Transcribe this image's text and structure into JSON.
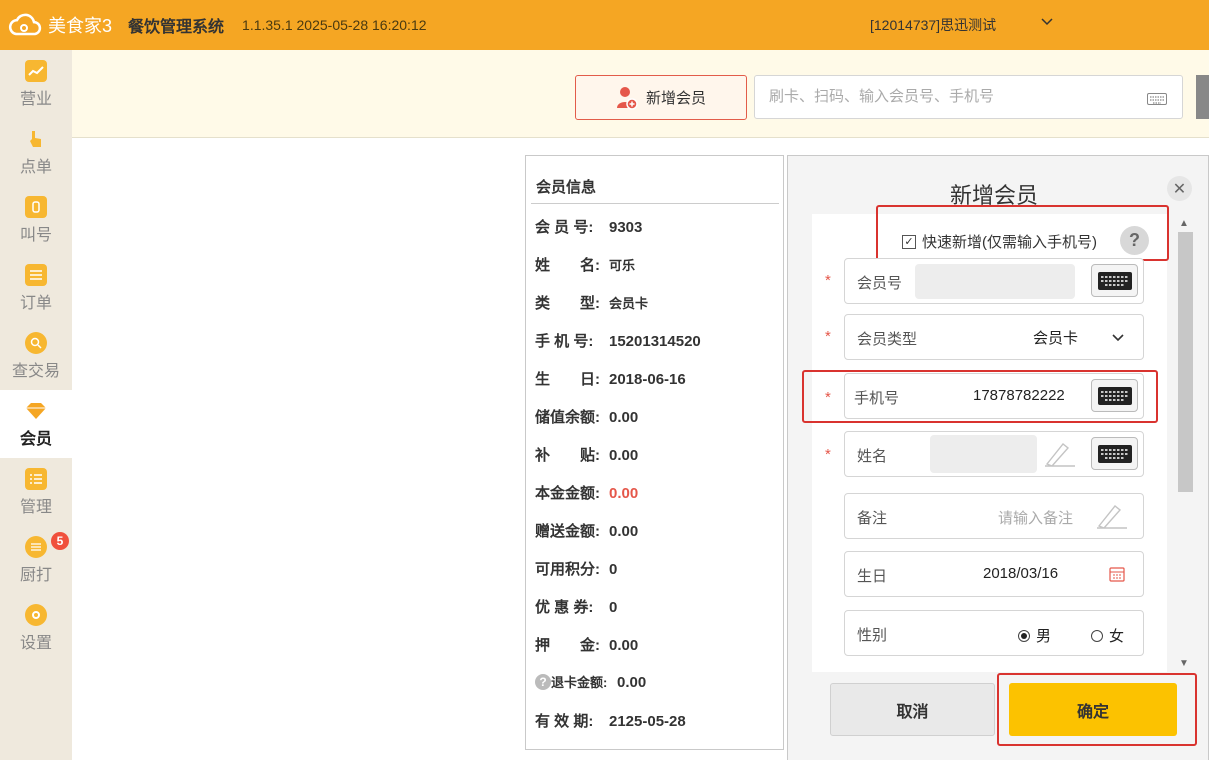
{
  "app": {
    "logo_text": "美食家3",
    "title": "餐饮管理系统",
    "version": "1.1.35.1 2025-05-28 16:20:12",
    "store": "[12014737]思迅测试"
  },
  "sidebar": {
    "items": [
      {
        "label": "营业",
        "icon": "chart-icon"
      },
      {
        "label": "点单",
        "icon": "hand-icon"
      },
      {
        "label": "叫号",
        "icon": "ticket-icon"
      },
      {
        "label": "订单",
        "icon": "list-icon"
      },
      {
        "label": "查交易",
        "icon": "search-icon"
      },
      {
        "label": "会员",
        "icon": "diamond-icon",
        "active": true
      },
      {
        "label": "管理",
        "icon": "checklist-icon"
      },
      {
        "label": "厨打",
        "icon": "printer-icon",
        "badge": "5"
      },
      {
        "label": "设置",
        "icon": "gear-icon"
      }
    ]
  },
  "header": {
    "add_member_label": "新增会员",
    "search_placeholder": "刷卡、扫码、输入会员号、手机号"
  },
  "member_info": {
    "title": "会员信息",
    "rows": [
      {
        "key": "会 员 号:",
        "value": "9303"
      },
      {
        "key": "姓　　名:",
        "value": "可乐"
      },
      {
        "key": "类　　型:",
        "value": "会员卡"
      },
      {
        "key": "手 机 号:",
        "value": "15201314520"
      },
      {
        "key": "生　　日:",
        "value": "2018-06-16"
      },
      {
        "key": "储值余额:",
        "value": "0.00"
      },
      {
        "key": "补　　贴:",
        "value": "0.00"
      },
      {
        "key": "本金金额:",
        "value": "0.00"
      },
      {
        "key": "赠送金额:",
        "value": "0.00"
      },
      {
        "key": "可用积分:",
        "value": "0"
      },
      {
        "key": "优 惠 券:",
        "value": "0"
      },
      {
        "key": "押　　金:",
        "value": "0.00"
      },
      {
        "key": "退卡金额:",
        "value": "0.00"
      },
      {
        "key": "有 效 期:",
        "value": "2125-05-28"
      }
    ]
  },
  "form": {
    "title": "新增会员",
    "quick_add_label": "快速新增(仅需输入手机号)",
    "quick_add_checked": true,
    "help": "?",
    "fields": {
      "member_no": {
        "label": "会员号",
        "value": ""
      },
      "member_type": {
        "label": "会员类型",
        "value": "会员卡"
      },
      "phone": {
        "label": "手机号",
        "value": "17878782222"
      },
      "name": {
        "label": "姓名",
        "value": ""
      },
      "remark": {
        "label": "备注",
        "placeholder": "请输入备注"
      },
      "birthday": {
        "label": "生日",
        "value": "2018/03/16"
      },
      "gender": {
        "label": "性别",
        "options": [
          "男",
          "女"
        ],
        "selected": "男"
      }
    },
    "cancel_label": "取消",
    "confirm_label": "确定"
  },
  "colors": {
    "topbar": "#f5a623",
    "confirm": "#fcc200",
    "highlight": "#d9332f",
    "red_value": "#e5574a"
  }
}
